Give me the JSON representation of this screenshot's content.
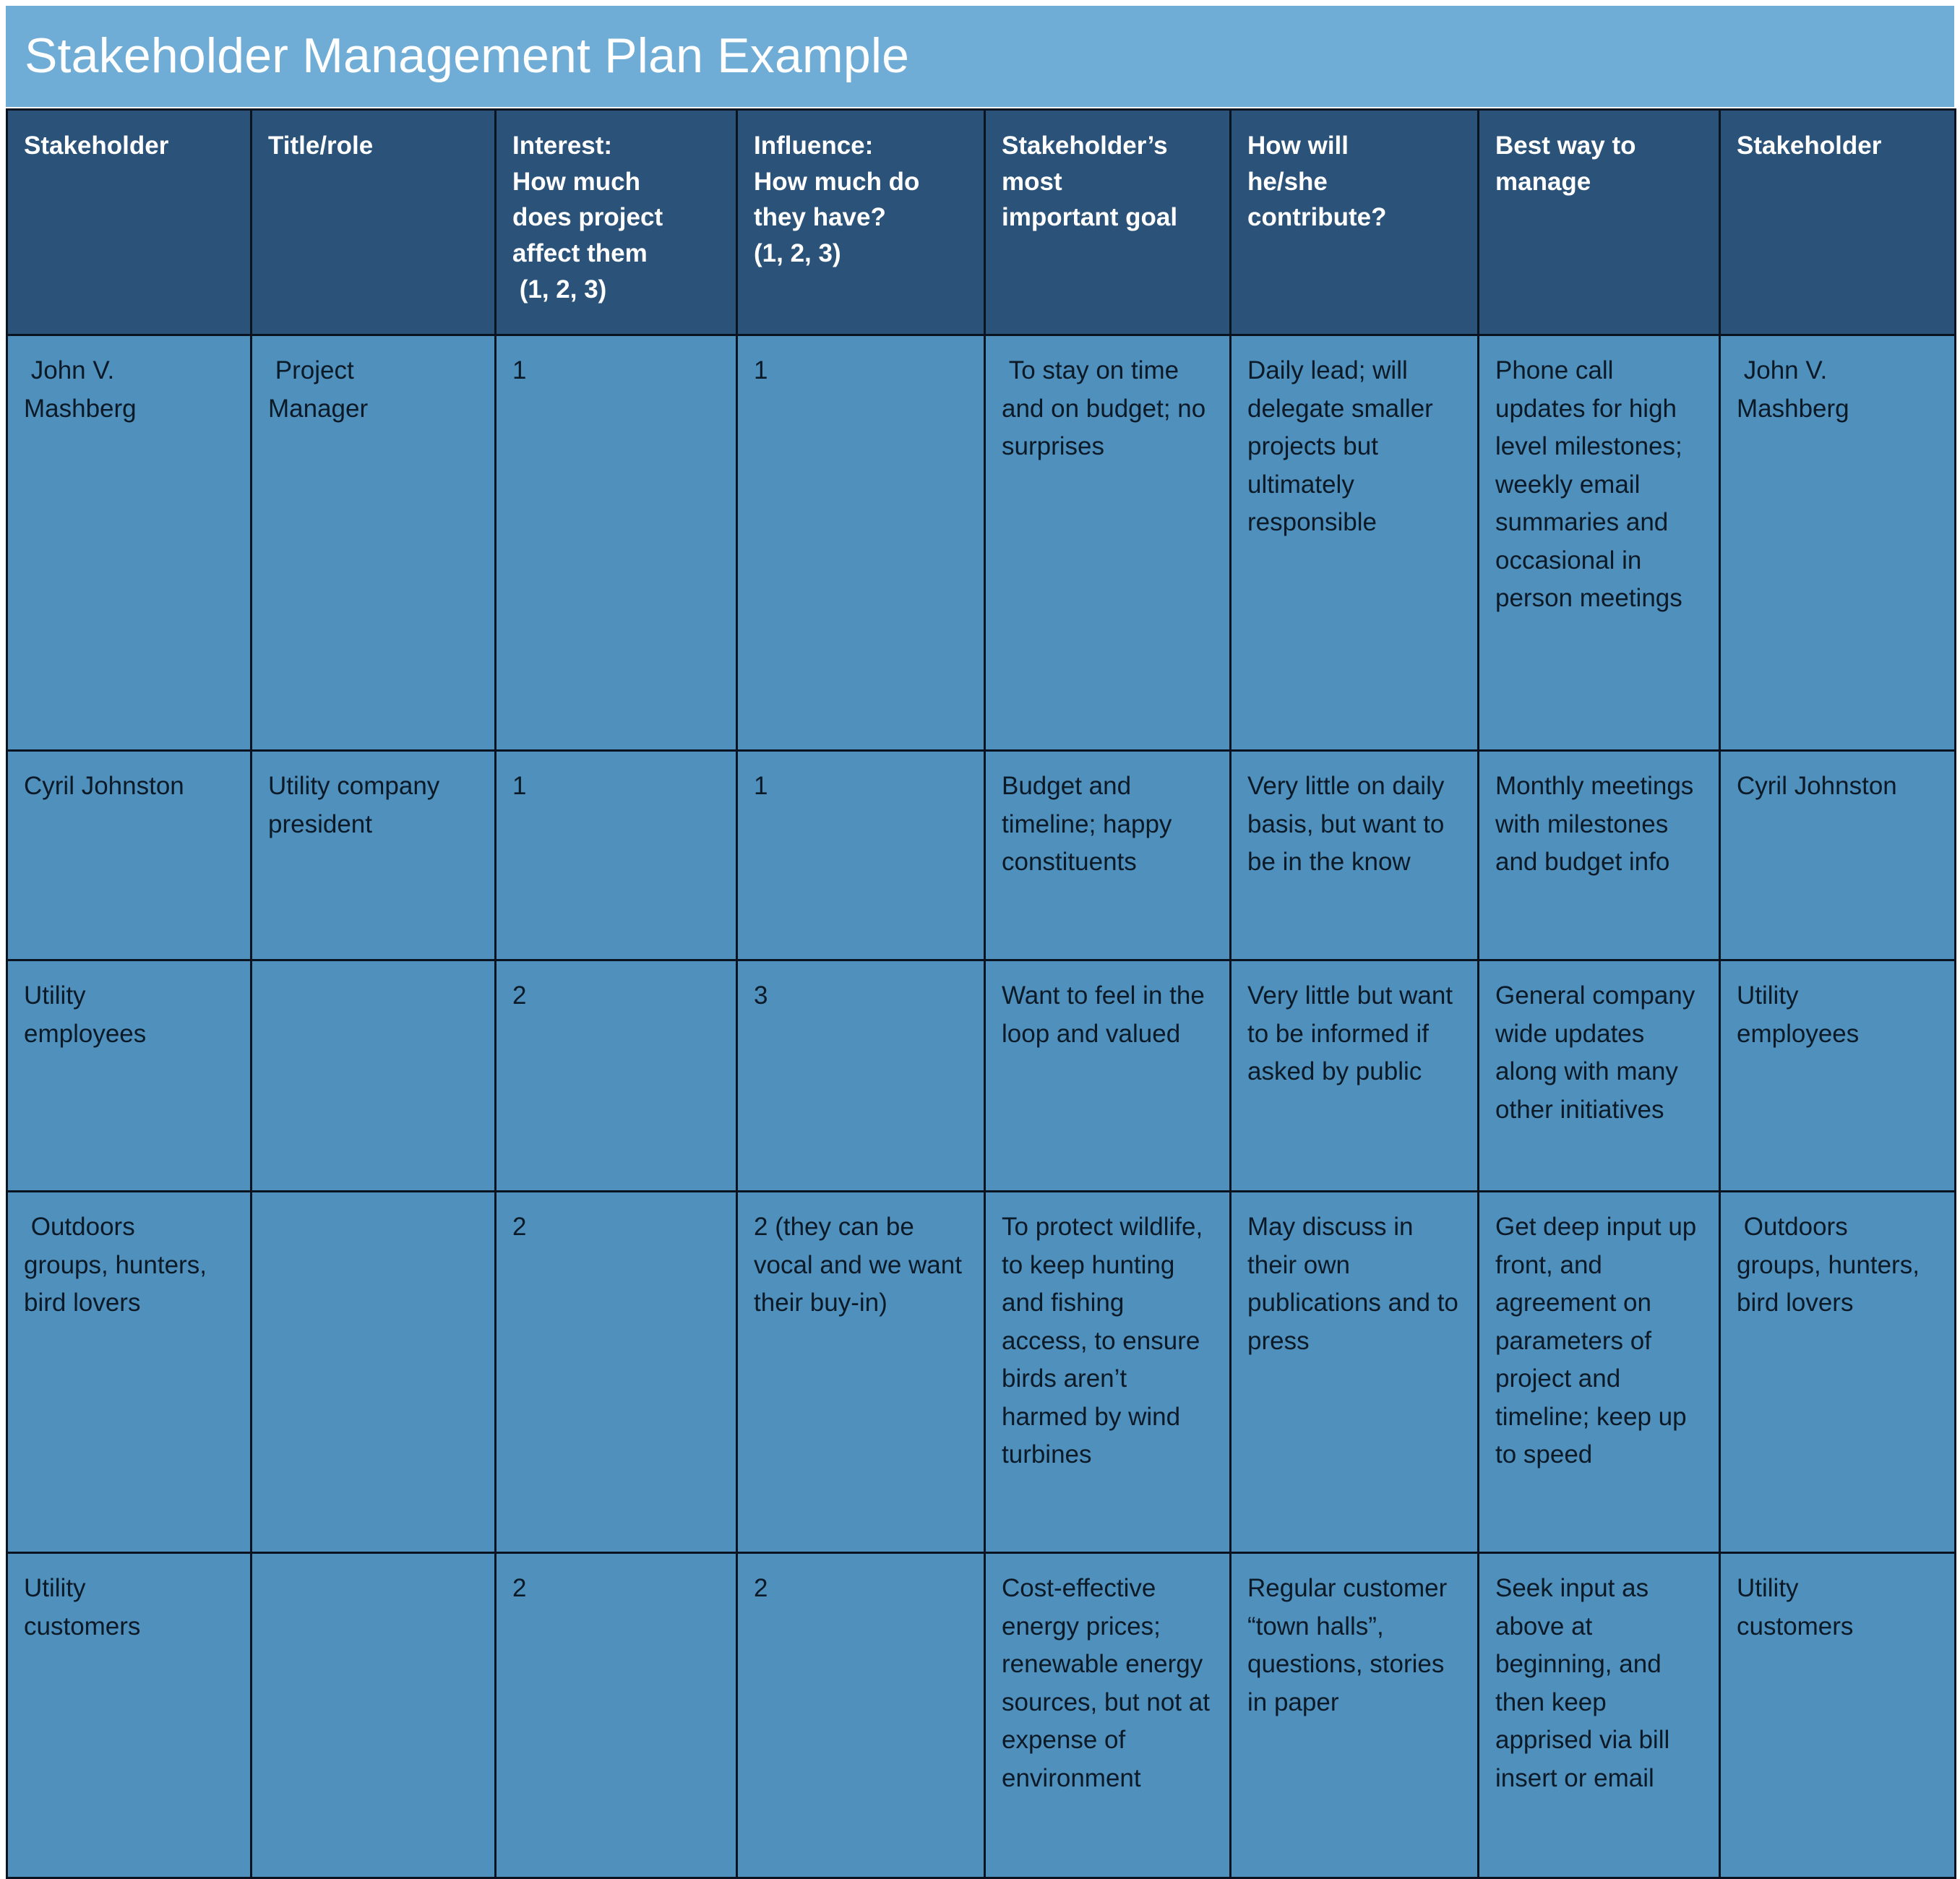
{
  "title": "Stakeholder Management Plan Example",
  "colors": {
    "banner": "#6fadd6",
    "header_row": "#2b5278",
    "body_cell": "#4f90bc",
    "grid_line": "#0a1420",
    "header_text": "#ffffff",
    "body_text": "#0c1a28"
  },
  "table": {
    "headers": [
      "Stakeholder",
      "Title/role",
      "Interest:\nHow much\ndoes project\naffect them\n (1, 2, 3)",
      "Influence:\nHow much do\nthey have?\n(1, 2, 3)",
      "Stakeholder’s\nmost\nimportant goal",
      "How will\nhe/she\ncontribute?",
      "Best way to\nmanage",
      "Stakeholder"
    ],
    "rows": [
      [
        " John V.\nMashberg",
        " Project\nManager",
        "1",
        "1",
        " To stay on time and on budget; no surprises",
        "Daily lead; will delegate smaller projects but ultimately responsible",
        "Phone call updates for high level milestones; weekly email summaries and occasional in person meetings",
        " John V.\nMashberg"
      ],
      [
        "Cyril Johnston",
        "Utility company president",
        "1",
        "1",
        "Budget and timeline; happy constituents",
        "Very little on daily basis, but want to be in the know",
        "Monthly meetings with milestones and budget info",
        "Cyril Johnston"
      ],
      [
        "Utility\nemployees",
        "",
        "2",
        "3",
        "Want to feel in the loop and valued",
        "Very little but want to be informed if asked by public",
        "General company wide updates along with many other initiatives",
        "Utility\nemployees"
      ],
      [
        " Outdoors\ngroups, hunters,\nbird lovers",
        "",
        "2",
        "2 (they can be vocal and we want their buy-in)",
        "To protect wildlife, to keep hunting and fishing access, to ensure birds aren’t harmed by wind turbines",
        "May discuss in their own publications and to press",
        "Get deep input up front, and agreement on parameters of project and timeline; keep up to speed",
        " Outdoors\ngroups, hunters,\nbird lovers"
      ],
      [
        "Utility\ncustomers",
        "",
        "2",
        "2",
        "Cost-effective energy prices; renewable energy sources, but not at expense of environment",
        "Regular customer “town halls”, questions, stories in paper",
        "Seek input as above at beginning, and then keep apprised via bill insert or email",
        "Utility\ncustomers"
      ]
    ]
  }
}
